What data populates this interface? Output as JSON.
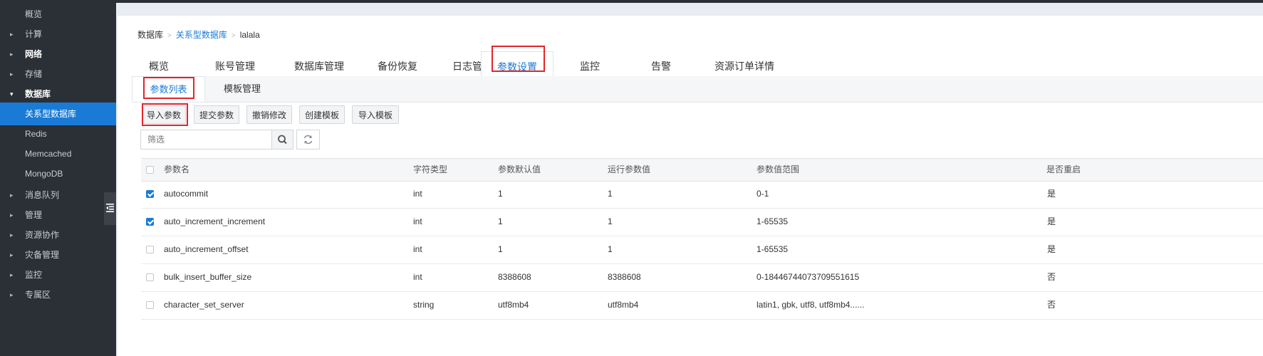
{
  "sidebar": {
    "items": [
      {
        "label": "概览",
        "caret": "",
        "style": "plain"
      },
      {
        "label": "计算",
        "caret": "▸",
        "style": "plain"
      },
      {
        "label": "网络",
        "caret": "▸",
        "style": "bold"
      },
      {
        "label": "存储",
        "caret": "▸",
        "style": "plain"
      },
      {
        "label": "数据库",
        "caret": "▾",
        "style": "bold-open"
      },
      {
        "label": "关系型数据库",
        "caret": "",
        "style": "active"
      },
      {
        "label": "Redis",
        "caret": "",
        "style": "sub"
      },
      {
        "label": "Memcached",
        "caret": "",
        "style": "sub"
      },
      {
        "label": "MongoDB",
        "caret": "",
        "style": "sub"
      },
      {
        "label": "消息队列",
        "caret": "▸",
        "style": "plain"
      },
      {
        "label": "管理",
        "caret": "▸",
        "style": "plain"
      },
      {
        "label": "资源协作",
        "caret": "▸",
        "style": "plain"
      },
      {
        "label": "灾备管理",
        "caret": "▸",
        "style": "plain"
      },
      {
        "label": "监控",
        "caret": "▸",
        "style": "plain"
      },
      {
        "label": "专属区",
        "caret": "▸",
        "style": "plain"
      }
    ]
  },
  "breadcrumb": {
    "root": "数据库",
    "section": "关系型数据库",
    "current": "lalala",
    "sep": ">"
  },
  "tabs": [
    "概览",
    "账号管理",
    "数据库管理",
    "备份恢复",
    "日志管理",
    "参数设置",
    "监控",
    "告警",
    "资源订单详情"
  ],
  "subtabs": [
    "参数列表",
    "模板管理"
  ],
  "toolbar": {
    "import": "导入参数",
    "submit": "提交参数",
    "undo": "撤销修改",
    "create_template": "创建模板",
    "import_template": "导入模板"
  },
  "search": {
    "placeholder": "筛选"
  },
  "table": {
    "headers": [
      "参数名",
      "字符类型",
      "参数默认值",
      "运行参数值",
      "参数值范围",
      "是否重启"
    ],
    "rows": [
      {
        "checked": true,
        "name": "autocommit",
        "type": "int",
        "default": "1",
        "running": "1",
        "range": "0-1",
        "restart": "是"
      },
      {
        "checked": true,
        "name": "auto_increment_increment",
        "type": "int",
        "default": "1",
        "running": "1",
        "range": "1-65535",
        "restart": "是"
      },
      {
        "checked": false,
        "name": "auto_increment_offset",
        "type": "int",
        "default": "1",
        "running": "1",
        "range": "1-65535",
        "restart": "是"
      },
      {
        "checked": false,
        "name": "bulk_insert_buffer_size",
        "type": "int",
        "default": "8388608",
        "running": "8388608",
        "range": "0-18446744073709551615",
        "restart": "否"
      },
      {
        "checked": false,
        "name": "character_set_server",
        "type": "string",
        "default": "utf8mb4",
        "running": "utf8mb4",
        "range": "latin1, gbk, utf8, utf8mb4......",
        "restart": "否"
      }
    ]
  },
  "colors": {
    "accent": "#1a7bd6",
    "highlight": "#e5232a",
    "sidebar_bg": "#2b2f36"
  }
}
